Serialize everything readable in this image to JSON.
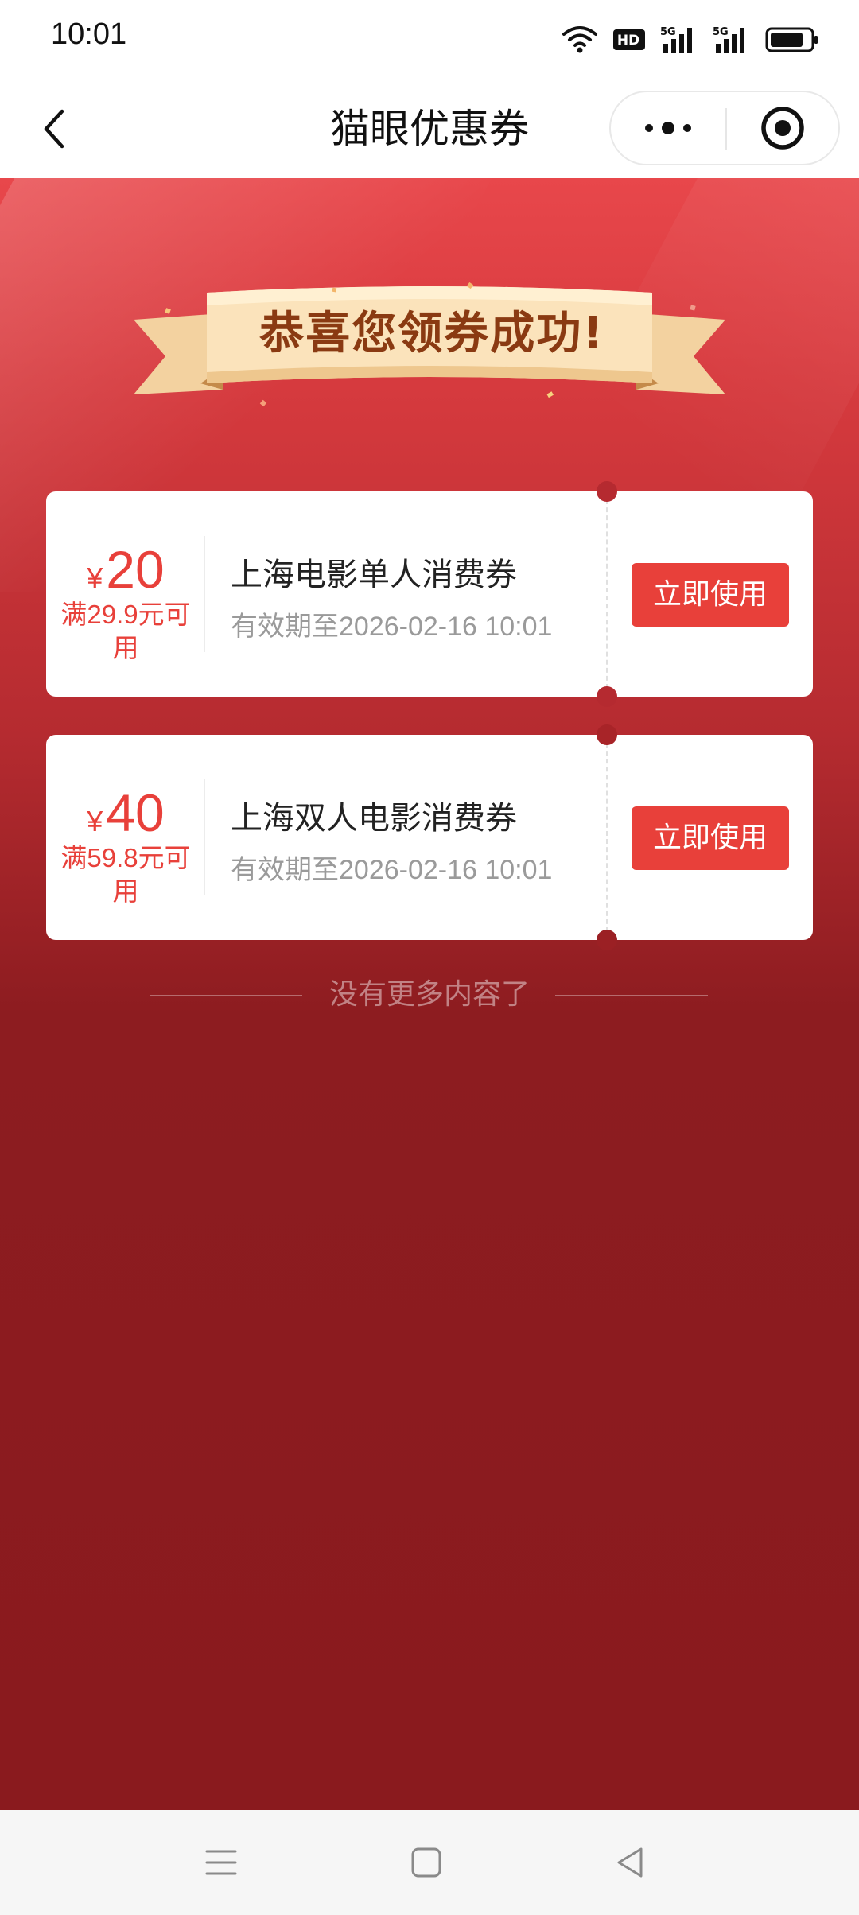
{
  "status_bar": {
    "time": "10:01",
    "icons": [
      "wifi-icon",
      "hd-icon",
      "signal-5g-icon",
      "signal-5g-icon",
      "battery-icon"
    ]
  },
  "nav": {
    "title": "猫眼优惠券",
    "back_icon": "chevron-left-icon",
    "more_icon": "more-dots-icon",
    "close_icon": "target-circle-icon"
  },
  "banner": {
    "text": "恭喜您领券成功!"
  },
  "coupons": [
    {
      "currency": "¥",
      "amount": "20",
      "condition": "满29.9元可用",
      "title": "上海电影单人消费券",
      "expiry": "有效期至2026-02-16 10:01",
      "button": "立即使用"
    },
    {
      "currency": "¥",
      "amount": "40",
      "condition": "满59.8元可用",
      "title": "上海双人电影消费券",
      "expiry": "有效期至2026-02-16 10:01",
      "button": "立即使用"
    }
  ],
  "end_text": "没有更多内容了",
  "system_nav": [
    "menu-icon",
    "home-square-icon",
    "back-triangle-icon"
  ],
  "colors": {
    "accent": "#e8403a",
    "background_top": "#e8474b",
    "background_bottom": "#8a1a1e"
  }
}
